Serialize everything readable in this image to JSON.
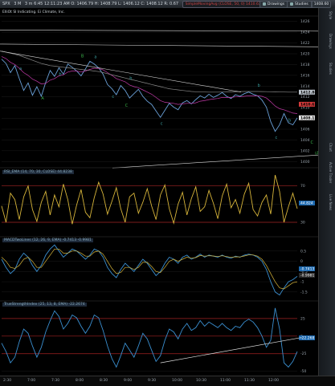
{
  "window": {
    "symbol": "SPX",
    "interval": "3 M",
    "header_text": "3 m 6:45 12:11:23 AM  O: 1406.79  H: 1408.79  L: 1406.12  C: 1408.12  R: 0.67",
    "chips": [
      {
        "label": "SimpleMovingAvg (CLOSE, 50, 0)  1410.63",
        "color": "red"
      },
      {
        "label": "SimpleMovingAvg (CLOSE)",
        "color": "blue"
      }
    ],
    "buttons": {
      "drawings_label": "Drawings",
      "studies_label": "Studies"
    },
    "price_readout": "1408.60",
    "subtitle": "ElliOt SI Indicating. Ei Climate, Inc."
  },
  "sidebar": {
    "tabs": [
      "Style",
      "Drawings",
      "Studies",
      "Chart",
      "Active Trader",
      "Live News"
    ]
  },
  "xaxis": {
    "ticks": [
      "2:30",
      "7:00",
      "7:30",
      "8:00",
      "8:30",
      "9:00",
      "9:30",
      "10:00",
      "10:30",
      "11:00",
      "11:30",
      "12:00"
    ]
  },
  "chart_data": [
    {
      "type": "line",
      "pane": "price",
      "yaxis_ticks": [
        "1426",
        "1424",
        "1422",
        "1420",
        "1418",
        "1416",
        "1414",
        "1412",
        "1410",
        "1408",
        "1406",
        "1404",
        "1402",
        "1400"
      ],
      "ylim": [
        1399,
        1427
      ],
      "price_labels": [
        {
          "value": "1412.88",
          "color": "#bfc7cf"
        },
        {
          "value": "1410.63",
          "color": "#d23a3a"
        },
        {
          "value": "1408.12",
          "color": "#e3e3e3"
        }
      ],
      "series": [
        {
          "name": "SPX",
          "color": "#6aa0d8",
          "values": [
            1419,
            1418.2,
            1416.5,
            1417.8,
            1415.4,
            1413.2,
            1414.6,
            1412.3,
            1413.9,
            1412.1,
            1414.7,
            1416.9,
            1415.8,
            1417.4,
            1416.2,
            1418.1,
            1417.5,
            1416.8,
            1415.9,
            1417.2,
            1418.6,
            1418.1,
            1417.4,
            1416.2,
            1414.3,
            1413.5,
            1412.4,
            1414.1,
            1413.2,
            1411.8,
            1412.6,
            1413.4,
            1412.1,
            1411.2,
            1410.6,
            1409.4,
            1408.2,
            1409.5,
            1410.8,
            1410.1,
            1409.6,
            1410.9,
            1411.3,
            1410.7,
            1411.5,
            1412.2,
            1411.8,
            1412.5,
            1411.9,
            1412.3,
            1412.8,
            1412.1,
            1411.7,
            1412.4,
            1412.1,
            1412.6,
            1412.9,
            1412.5,
            1412.2,
            1411.4,
            1410.1,
            1407.4,
            1405.6,
            1406.8,
            1408.9,
            1407.2,
            1406.8,
            1408.1
          ]
        },
        {
          "name": "",
          "color": "#c23aa8",
          "values": [
            1419.5,
            1419.1,
            1418.4,
            1418,
            1417.3,
            1416.5,
            1416,
            1415.3,
            1414.9,
            1414.4,
            1414.5,
            1415.1,
            1415.4,
            1415.9,
            1416.1,
            1416.6,
            1416.8,
            1416.8,
            1416.6,
            1416.8,
            1417.1,
            1417.3,
            1417.3,
            1417,
            1416.5,
            1416,
            1415.4,
            1415.1,
            1414.8,
            1414.2,
            1413.9,
            1413.7,
            1413.3,
            1412.9,
            1412.5,
            1411.9,
            1411.3,
            1411,
            1410.9,
            1410.8,
            1410.6,
            1410.7,
            1410.8,
            1410.8,
            1410.9,
            1411.2,
            1411.3,
            1411.5,
            1411.6,
            1411.7,
            1411.9,
            1411.9,
            1411.9,
            1412,
            1412,
            1412.1,
            1412.2,
            1412.2,
            1412.2,
            1412.1,
            1411.8,
            1411.1,
            1410.3,
            1409.8,
            1409.6,
            1409.3,
            1409,
            1408.9
          ]
        },
        {
          "name": "",
          "color": "#8a8a8a",
          "values": [
            1420.5,
            1420.3,
            1420.1,
            1419.9,
            1419.7,
            1419.4,
            1419.1,
            1418.8,
            1418.5,
            1418.2,
            1418,
            1417.8,
            1417.7,
            1417.6,
            1417.5,
            1417.4,
            1417.3,
            1417.2,
            1417.1,
            1417,
            1416.9,
            1416.8,
            1416.7,
            1416.5,
            1416.3,
            1416.1,
            1415.9,
            1415.7,
            1415.5,
            1415.3,
            1415.1,
            1414.9,
            1414.7,
            1414.5,
            1414.3,
            1414.1,
            1413.9,
            1413.7,
            1413.5,
            1413.4,
            1413.3,
            1413.2,
            1413.1,
            1413,
            1412.95,
            1412.9,
            1412.9,
            1412.88,
            1412.88,
            1412.88,
            1412.9,
            1412.92,
            1412.94,
            1412.96,
            1412.98,
            1413,
            1413,
            1413,
            1413,
            1412.99,
            1412.97,
            1412.95,
            1412.92,
            1412.9,
            1412.89,
            1412.88,
            1412.88,
            1412.88
          ]
        }
      ],
      "annotations": [
        {
          "text": "a",
          "x": 4,
          "y": 1417,
          "color": "#3aa0a0"
        },
        {
          "text": "A",
          "x": 9,
          "y": 1411.5,
          "color": "#3ab24a"
        },
        {
          "text": "b",
          "x": 13,
          "y": 1416,
          "color": "#3aa0a0"
        },
        {
          "text": "B",
          "x": 18,
          "y": 1419.3,
          "color": "#3ab24a"
        },
        {
          "text": "a",
          "x": 21,
          "y": 1419.2,
          "color": "#3aa0a0"
        },
        {
          "text": "c",
          "x": 25,
          "y": 1411.8,
          "color": "#3aa0a0"
        },
        {
          "text": "b",
          "x": 29,
          "y": 1415.2,
          "color": "#3aa0a0"
        },
        {
          "text": "C",
          "x": 28,
          "y": 1410.2,
          "color": "#3ab24a"
        },
        {
          "text": "c",
          "x": 36,
          "y": 1406.8,
          "color": "#3aa0a0"
        },
        {
          "text": "b",
          "x": 58,
          "y": 1413.9,
          "color": "#3aa0a0"
        },
        {
          "text": "c",
          "x": 62,
          "y": 1404.2,
          "color": "#3aa0a0"
        },
        {
          "text": "b",
          "x": 65,
          "y": 1407.4,
          "color": "#3aa0a0"
        },
        {
          "text": "C",
          "x": 70,
          "y": 1403.3,
          "color": "#3ab24a"
        },
        {
          "text": "(A) ??",
          "x": 71,
          "y": 1401.3,
          "color": "#3ab24a"
        }
      ]
    },
    {
      "type": "line",
      "pane": "rsi",
      "label": "RSI_EMA (14, 70, 30, CLOSE)  44.8238",
      "yaxis_ticks": [
        "70",
        "50",
        "30"
      ],
      "ylim": [
        15,
        90
      ],
      "levels": [
        70,
        30
      ],
      "readout": "44.824",
      "series": [
        {
          "name": "RSI_EMA",
          "color": "#d6b43a",
          "values": [
            48,
            30,
            62,
            55,
            33,
            58,
            70,
            44,
            31,
            52,
            64,
            38,
            60,
            47,
            72,
            55,
            28,
            49,
            66,
            41,
            35,
            57,
            74,
            61,
            39,
            53,
            68,
            45,
            30,
            58,
            62,
            40,
            52,
            67,
            48,
            33,
            60,
            71,
            45,
            29,
            50,
            63,
            38,
            56,
            69,
            42,
            47,
            65,
            51,
            34,
            59,
            72,
            46,
            55,
            40,
            61,
            73,
            44,
            37,
            52,
            60,
            39,
            82,
            64,
            30,
            47,
            62,
            45
          ]
        }
      ]
    },
    {
      "type": "line",
      "pane": "macd",
      "label": "MACDTwoLines (12, 26, 9, EMA)  -0.7413  -0.9981",
      "yaxis_ticks": [
        "0.5",
        "0",
        "-0.5",
        "-1",
        "-1.5"
      ],
      "ylim": [
        -1.9,
        1.2
      ],
      "readouts": [
        "-0.7413",
        "-0.9981"
      ],
      "series": [
        {
          "name": "MACD",
          "color": "#3a8fd0",
          "values": [
            0.1,
            -0.3,
            -0.6,
            -0.4,
            0.1,
            0.4,
            0.2,
            -0.2,
            -0.5,
            -0.2,
            0.3,
            0.6,
            0.8,
            0.5,
            0.2,
            0.4,
            0.6,
            0.5,
            0.3,
            0.1,
            0.3,
            0.6,
            0.5,
            0.2,
            -0.3,
            -0.6,
            -0.8,
            -0.4,
            -0.1,
            -0.3,
            -0.5,
            -0.2,
            0.1,
            -0.1,
            -0.4,
            -0.7,
            -0.5,
            -0.1,
            0.2,
            0.1,
            -0.1,
            0.2,
            0.3,
            0.1,
            0.2,
            0.35,
            0.2,
            0.3,
            0.25,
            0.2,
            0.3,
            0.2,
            0.15,
            0.25,
            0.2,
            0.3,
            0.35,
            0.3,
            0.2,
            0.0,
            -0.4,
            -1.0,
            -1.5,
            -1.65,
            -1.3,
            -1.0,
            -0.9,
            -0.74
          ]
        },
        {
          "name": "Signal",
          "color": "#d6b43a",
          "values": [
            0.2,
            0.0,
            -0.3,
            -0.35,
            -0.2,
            0.1,
            0.2,
            0.0,
            -0.3,
            -0.3,
            0.0,
            0.3,
            0.6,
            0.6,
            0.4,
            0.4,
            0.5,
            0.5,
            0.4,
            0.25,
            0.25,
            0.45,
            0.5,
            0.35,
            0.0,
            -0.35,
            -0.6,
            -0.55,
            -0.3,
            -0.3,
            -0.4,
            -0.3,
            -0.05,
            -0.05,
            -0.25,
            -0.5,
            -0.55,
            -0.3,
            0.0,
            0.1,
            0.0,
            0.1,
            0.2,
            0.15,
            0.18,
            0.28,
            0.25,
            0.27,
            0.26,
            0.23,
            0.27,
            0.23,
            0.19,
            0.22,
            0.21,
            0.26,
            0.31,
            0.31,
            0.25,
            0.1,
            -0.2,
            -0.6,
            -1.0,
            -1.3,
            -1.35,
            -1.2,
            -1.05,
            -1.0
          ]
        }
      ]
    },
    {
      "type": "line",
      "pane": "tsi",
      "label": "TrueStrengthIndex (25, 13, 8, EMA)  -22.2674",
      "yaxis_ticks": [
        "25",
        "0",
        "-25",
        "-50"
      ],
      "ylim": [
        -55,
        50
      ],
      "levels": [
        25,
        0,
        -25
      ],
      "readout": "-22.268",
      "series": [
        {
          "name": "TSI",
          "color": "#3a8fd0",
          "values": [
            -10,
            -22,
            -38,
            -30,
            -8,
            10,
            4,
            -14,
            -30,
            -16,
            6,
            22,
            36,
            28,
            10,
            18,
            30,
            26,
            14,
            4,
            14,
            30,
            26,
            8,
            -14,
            -32,
            -44,
            -28,
            -10,
            -20,
            -30,
            -14,
            4,
            -4,
            -20,
            -36,
            -28,
            -6,
            10,
            6,
            -4,
            10,
            18,
            8,
            12,
            22,
            14,
            20,
            16,
            12,
            18,
            12,
            8,
            14,
            12,
            20,
            24,
            20,
            12,
            0,
            -16,
            -6,
            40,
            10,
            -38,
            -44,
            -36,
            -22
          ]
        }
      ],
      "trendline": {
        "from": [
          36,
          -38
        ],
        "to": [
          68,
          -2
        ],
        "color": "#e0e0e0"
      }
    }
  ]
}
